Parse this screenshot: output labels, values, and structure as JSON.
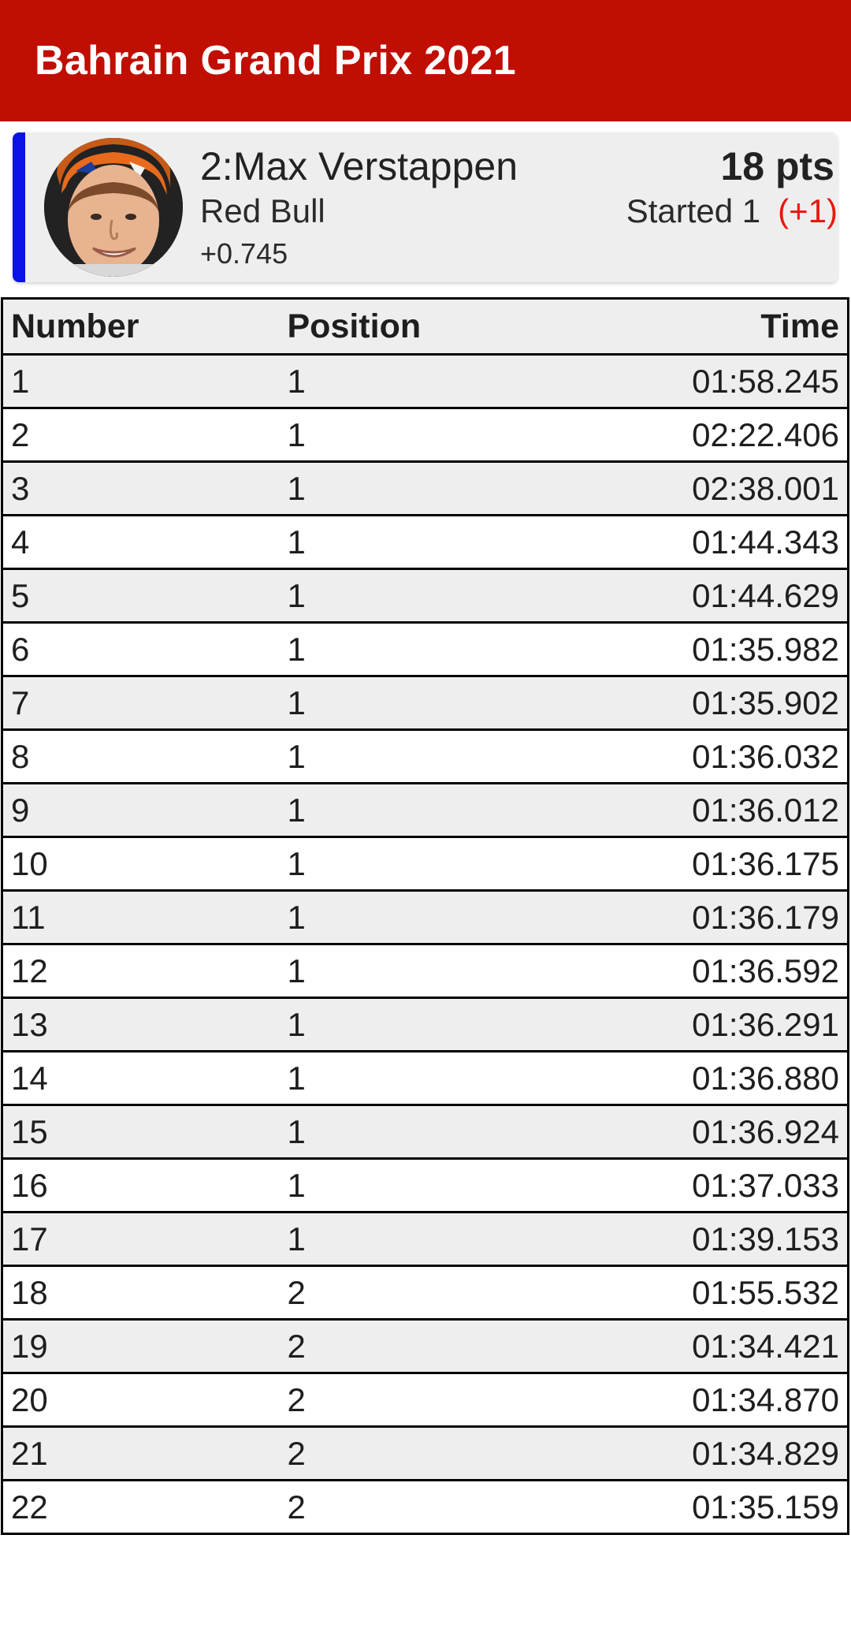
{
  "header": {
    "title": "Bahrain Grand Prix 2021"
  },
  "driver": {
    "name": "2:Max Verstappen",
    "team": "Red Bull",
    "gap": "+0.745",
    "points": "18 pts",
    "started": "Started 1",
    "position_change": "(+1)",
    "team_color": "#0a12e8",
    "change_color": "#e8160c",
    "avatar_icon": "driver-portrait"
  },
  "table": {
    "headers": {
      "number": "Number",
      "position": "Position",
      "time": "Time"
    },
    "rows": [
      {
        "number": "1",
        "position": "1",
        "time": "01:58.245"
      },
      {
        "number": "2",
        "position": "1",
        "time": "02:22.406"
      },
      {
        "number": "3",
        "position": "1",
        "time": "02:38.001"
      },
      {
        "number": "4",
        "position": "1",
        "time": "01:44.343"
      },
      {
        "number": "5",
        "position": "1",
        "time": "01:44.629"
      },
      {
        "number": "6",
        "position": "1",
        "time": "01:35.982"
      },
      {
        "number": "7",
        "position": "1",
        "time": "01:35.902"
      },
      {
        "number": "8",
        "position": "1",
        "time": "01:36.032"
      },
      {
        "number": "9",
        "position": "1",
        "time": "01:36.012"
      },
      {
        "number": "10",
        "position": "1",
        "time": "01:36.175"
      },
      {
        "number": "11",
        "position": "1",
        "time": "01:36.179"
      },
      {
        "number": "12",
        "position": "1",
        "time": "01:36.592"
      },
      {
        "number": "13",
        "position": "1",
        "time": "01:36.291"
      },
      {
        "number": "14",
        "position": "1",
        "time": "01:36.880"
      },
      {
        "number": "15",
        "position": "1",
        "time": "01:36.924"
      },
      {
        "number": "16",
        "position": "1",
        "time": "01:37.033"
      },
      {
        "number": "17",
        "position": "1",
        "time": "01:39.153"
      },
      {
        "number": "18",
        "position": "2",
        "time": "01:55.532"
      },
      {
        "number": "19",
        "position": "2",
        "time": "01:34.421"
      },
      {
        "number": "20",
        "position": "2",
        "time": "01:34.870"
      },
      {
        "number": "21",
        "position": "2",
        "time": "01:34.829"
      },
      {
        "number": "22",
        "position": "2",
        "time": "01:35.159"
      }
    ]
  }
}
